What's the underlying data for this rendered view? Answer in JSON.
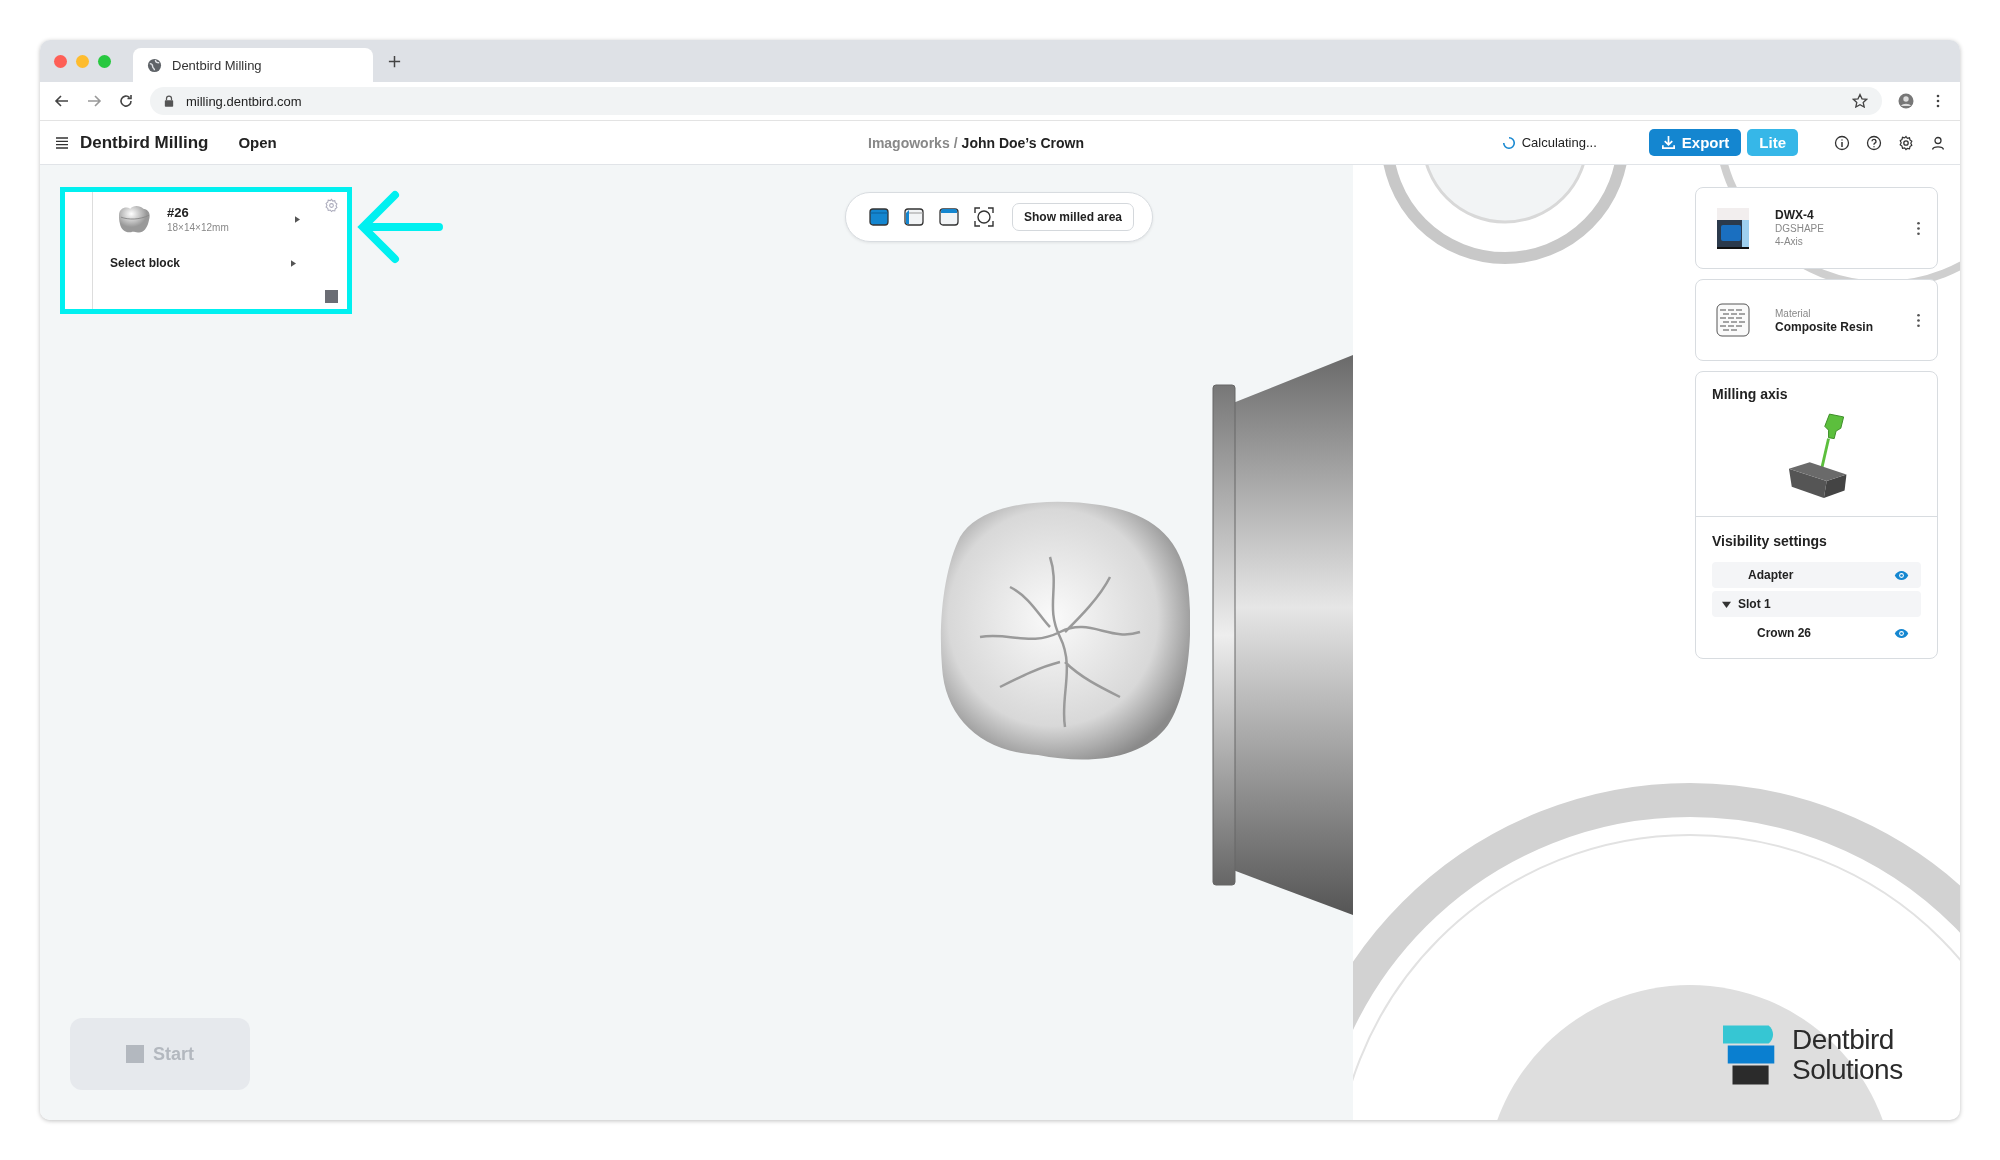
{
  "browser": {
    "tab_title": "Dentbird Milling",
    "url": "milling.dentbird.com"
  },
  "header": {
    "app_name": "Dentbird Milling",
    "open_label": "Open",
    "breadcrumb_parent": "Imagoworks",
    "breadcrumb_separator": "/",
    "breadcrumb_current": "John Doe’s Crown",
    "status": "Calculating...",
    "export_label": "Export",
    "plan_badge": "Lite"
  },
  "job_card": {
    "tooth": "#26",
    "size": "18×14×12mm",
    "block_label": "Select block"
  },
  "view_toolbar": {
    "views": [
      {
        "kind": "top"
      },
      {
        "kind": "side"
      },
      {
        "kind": "front"
      },
      {
        "kind": "fit"
      }
    ],
    "milled_button": "Show milled area"
  },
  "machine": {
    "name": "DWX-4",
    "maker": "DGSHAPE",
    "axis": "4-Axis"
  },
  "material": {
    "caption": "Material",
    "name": "Composite Resin"
  },
  "milling_axis": {
    "title": "Milling axis"
  },
  "visibility": {
    "title": "Visibility settings",
    "items": [
      {
        "label": "Adapter",
        "visible": true
      },
      {
        "label": "Slot 1",
        "expanded": true,
        "children": [
          {
            "label": "Crown 26",
            "visible": true
          }
        ]
      }
    ]
  },
  "start_button": {
    "label": "Start",
    "disabled": true
  },
  "logo": {
    "line1": "Dentbird",
    "line2": "Solutions"
  }
}
